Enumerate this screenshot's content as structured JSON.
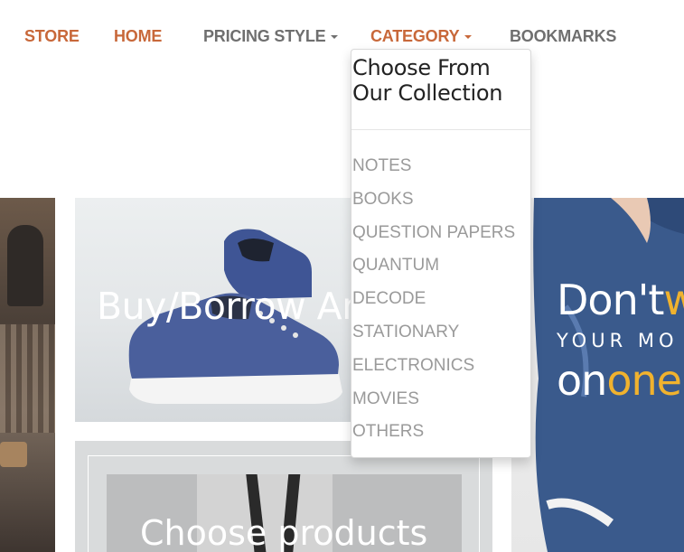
{
  "nav": {
    "store": "STORE",
    "home": "HOME",
    "pricing_style": "PRICING STYLE",
    "category": "CATEGORY",
    "bookmarks": "BOOKMARKS"
  },
  "dropdown": {
    "heading": "Choose From Our Collection",
    "items": [
      "NOTES",
      "BOOKS",
      "QUESTION PAPERS",
      "QUANTUM",
      "DECODE",
      "STATIONARY",
      "ELECTRONICS",
      "MOVIES",
      "OTHERS"
    ]
  },
  "hero": {
    "shoe_text": "Buy/Borrow An",
    "suit_text": "Choose products",
    "jeans_line1_a": "Don't",
    "jeans_line1_b": "w",
    "jeans_line2": "YOUR MO",
    "jeans_line3_a": "on",
    "jeans_line3_b": "one"
  },
  "colors": {
    "nav_orange": "#c8683a",
    "nav_gray": "#6f6f6f",
    "dropdown_item": "#9a9a9a",
    "accent_yellow": "#f0b22e"
  }
}
